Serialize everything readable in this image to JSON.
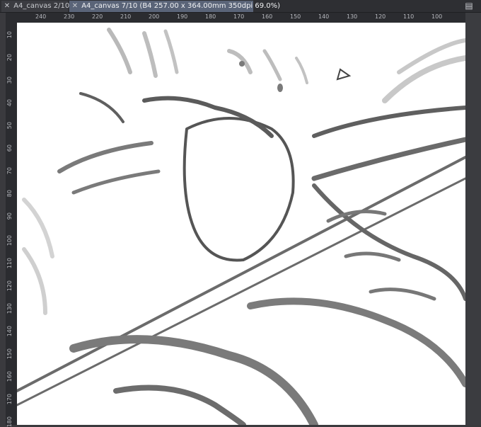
{
  "tabs": [
    {
      "label": "A4_canvas 2/10",
      "active": false
    },
    {
      "label": "A4_canvas 7/10 (B4 257.00 x 364.00mm 350dpi 69.0%)",
      "active": true
    }
  ],
  "ruler": {
    "top_ticks": [
      "240",
      "230",
      "220",
      "210",
      "200",
      "190",
      "180",
      "170",
      "160",
      "150",
      "140",
      "130",
      "120",
      "110",
      "100"
    ],
    "left_ticks": [
      "10",
      "20",
      "30",
      "40",
      "50",
      "60",
      "70",
      "80",
      "90",
      "100",
      "110",
      "120",
      "130",
      "140",
      "150",
      "160",
      "170",
      "180"
    ]
  },
  "icons": {
    "tab_menu": "tab-menu-icon",
    "tab_close": "close-icon"
  }
}
